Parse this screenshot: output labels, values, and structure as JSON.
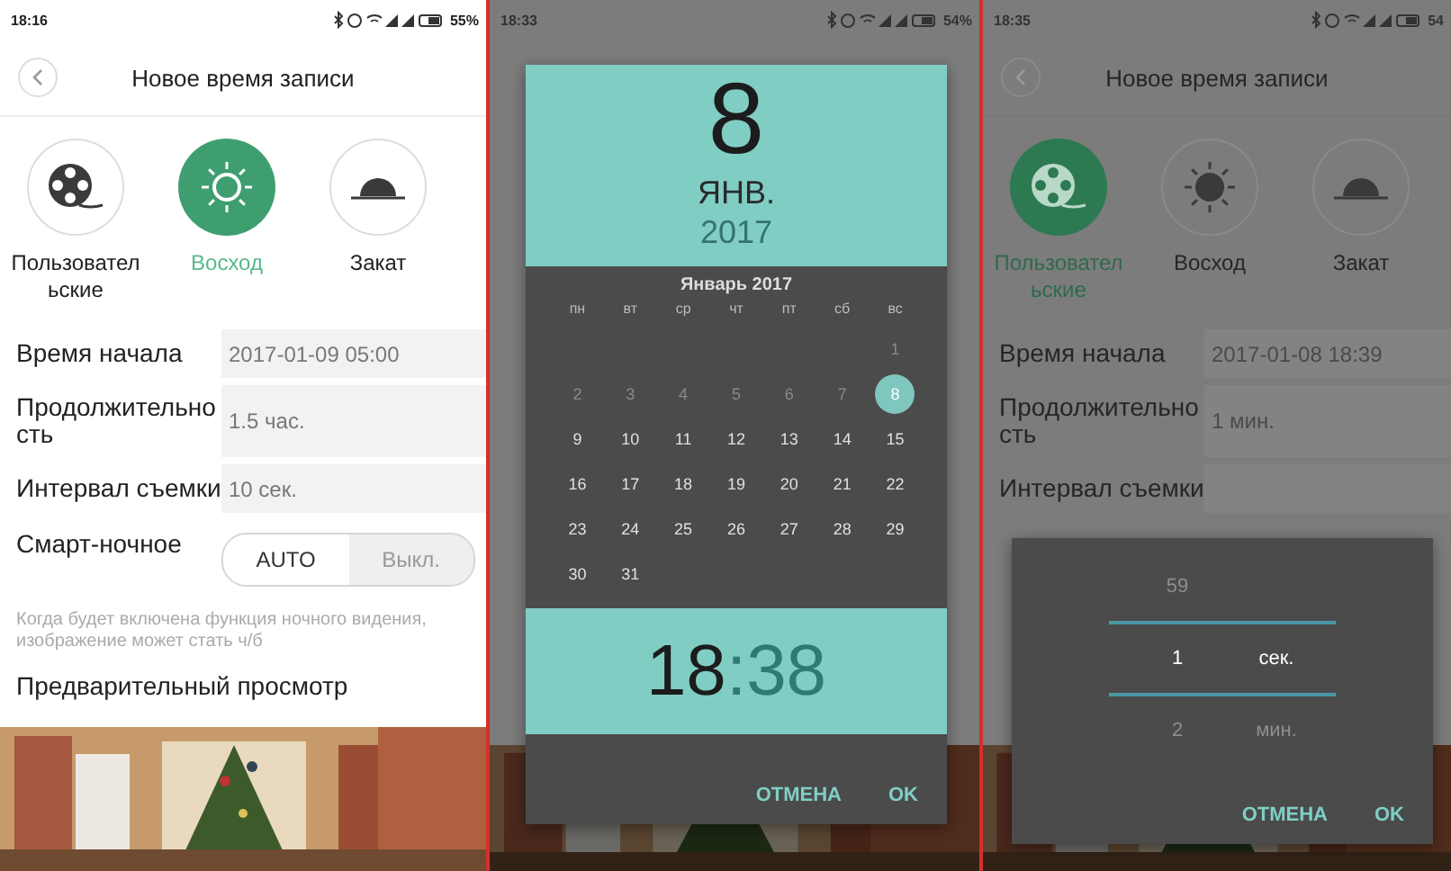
{
  "screens": [
    {
      "kind": "form",
      "dimmed": false,
      "status": {
        "time": "18:16",
        "battery": "55%"
      },
      "title": "Новое время записи",
      "modes": [
        {
          "label": "Пользовательские",
          "selected": false
        },
        {
          "label": "Восход",
          "selected": true
        },
        {
          "label": "Закат",
          "selected": false
        }
      ],
      "rows": [
        {
          "label": "Время начала",
          "value": "2017-01-09 05:00"
        },
        {
          "label": "Продолжительность",
          "value": "1.5 час."
        },
        {
          "label": "Интервал съемки",
          "value": "10 сек."
        }
      ],
      "night": {
        "label": "Смарт-ночное",
        "options": [
          {
            "label": "AUTO",
            "selected": true
          },
          {
            "label": "Выкл.",
            "selected": false
          }
        ]
      },
      "note": "Когда будет включена функция ночного видения, изображение может стать ч/б",
      "preview_title": "Предварительный просмотр"
    },
    {
      "kind": "date_picker",
      "dimmed": true,
      "status": {
        "time": "18:33",
        "battery": "54%"
      },
      "dialog": {
        "day": "8",
        "month": "ЯНВ.",
        "year": "2017",
        "calendar_title": "Январь 2017",
        "weekdays": [
          "пн",
          "вт",
          "ср",
          "чт",
          "пт",
          "сб",
          "вс"
        ],
        "weeks": [
          [
            {
              "kind": "blank"
            },
            {
              "kind": "blank"
            },
            {
              "kind": "blank"
            },
            {
              "kind": "blank"
            },
            {
              "kind": "blank"
            },
            {
              "kind": "blank"
            },
            {
              "kind": "day",
              "label": "1",
              "disabled": true,
              "selected": false
            }
          ],
          [
            {
              "kind": "day",
              "label": "2",
              "disabled": true,
              "selected": false
            },
            {
              "kind": "day",
              "label": "3",
              "disabled": true,
              "selected": false
            },
            {
              "kind": "day",
              "label": "4",
              "disabled": true,
              "selected": false
            },
            {
              "kind": "day",
              "label": "5",
              "disabled": true,
              "selected": false
            },
            {
              "kind": "day",
              "label": "6",
              "disabled": true,
              "selected": false
            },
            {
              "kind": "day",
              "label": "7",
              "disabled": true,
              "selected": false
            },
            {
              "kind": "day",
              "label": "8",
              "disabled": false,
              "selected": true
            }
          ],
          [
            {
              "kind": "day",
              "label": "9",
              "disabled": false,
              "selected": false
            },
            {
              "kind": "day",
              "label": "10",
              "disabled": false,
              "selected": false
            },
            {
              "kind": "day",
              "label": "11",
              "disabled": false,
              "selected": false
            },
            {
              "kind": "day",
              "label": "12",
              "disabled": false,
              "selected": false
            },
            {
              "kind": "day",
              "label": "13",
              "disabled": false,
              "selected": false
            },
            {
              "kind": "day",
              "label": "14",
              "disabled": false,
              "selected": false
            },
            {
              "kind": "day",
              "label": "15",
              "disabled": false,
              "selected": false
            }
          ],
          [
            {
              "kind": "day",
              "label": "16",
              "disabled": false,
              "selected": false
            },
            {
              "kind": "day",
              "label": "17",
              "disabled": false,
              "selected": false
            },
            {
              "kind": "day",
              "label": "18",
              "disabled": false,
              "selected": false
            },
            {
              "kind": "day",
              "label": "19",
              "disabled": false,
              "selected": false
            },
            {
              "kind": "day",
              "label": "20",
              "disabled": false,
              "selected": false
            },
            {
              "kind": "day",
              "label": "21",
              "disabled": false,
              "selected": false
            },
            {
              "kind": "day",
              "label": "22",
              "disabled": false,
              "selected": false
            }
          ],
          [
            {
              "kind": "day",
              "label": "23",
              "disabled": false,
              "selected": false
            },
            {
              "kind": "day",
              "label": "24",
              "disabled": false,
              "selected": false
            },
            {
              "kind": "day",
              "label": "25",
              "disabled": false,
              "selected": false
            },
            {
              "kind": "day",
              "label": "26",
              "disabled": false,
              "selected": false
            },
            {
              "kind": "day",
              "label": "27",
              "disabled": false,
              "selected": false
            },
            {
              "kind": "day",
              "label": "28",
              "disabled": false,
              "selected": false
            },
            {
              "kind": "day",
              "label": "29",
              "disabled": false,
              "selected": false
            }
          ],
          [
            {
              "kind": "day",
              "label": "30",
              "disabled": false,
              "selected": false
            },
            {
              "kind": "day",
              "label": "31",
              "disabled": false,
              "selected": false
            }
          ]
        ],
        "hours": "18",
        "separator": ":",
        "minutes": "38",
        "buttons": [
          "ОТМЕНА",
          "OK"
        ]
      }
    },
    {
      "kind": "form",
      "dimmed": true,
      "status": {
        "time": "18:35",
        "battery": "54"
      },
      "title": "Новое время записи",
      "modes": [
        {
          "label": "Пользовательские",
          "selected": true
        },
        {
          "label": "Восход",
          "selected": false
        },
        {
          "label": "Закат",
          "selected": false
        }
      ],
      "rows": [
        {
          "label": "Время начала",
          "value": "2017-01-08 18:39"
        },
        {
          "label": "Продолжительность",
          "value": "1 мин."
        },
        {
          "label": "Интервал съемки"
        }
      ],
      "picker": {
        "items": [
          {
            "number": "59",
            "selected": false
          },
          {
            "number": "1",
            "unit": "сек.",
            "selected": true
          },
          {
            "number": "2",
            "unit": "мин.",
            "selected": false
          }
        ],
        "buttons": [
          "ОТМЕНА",
          "OK"
        ]
      }
    }
  ]
}
